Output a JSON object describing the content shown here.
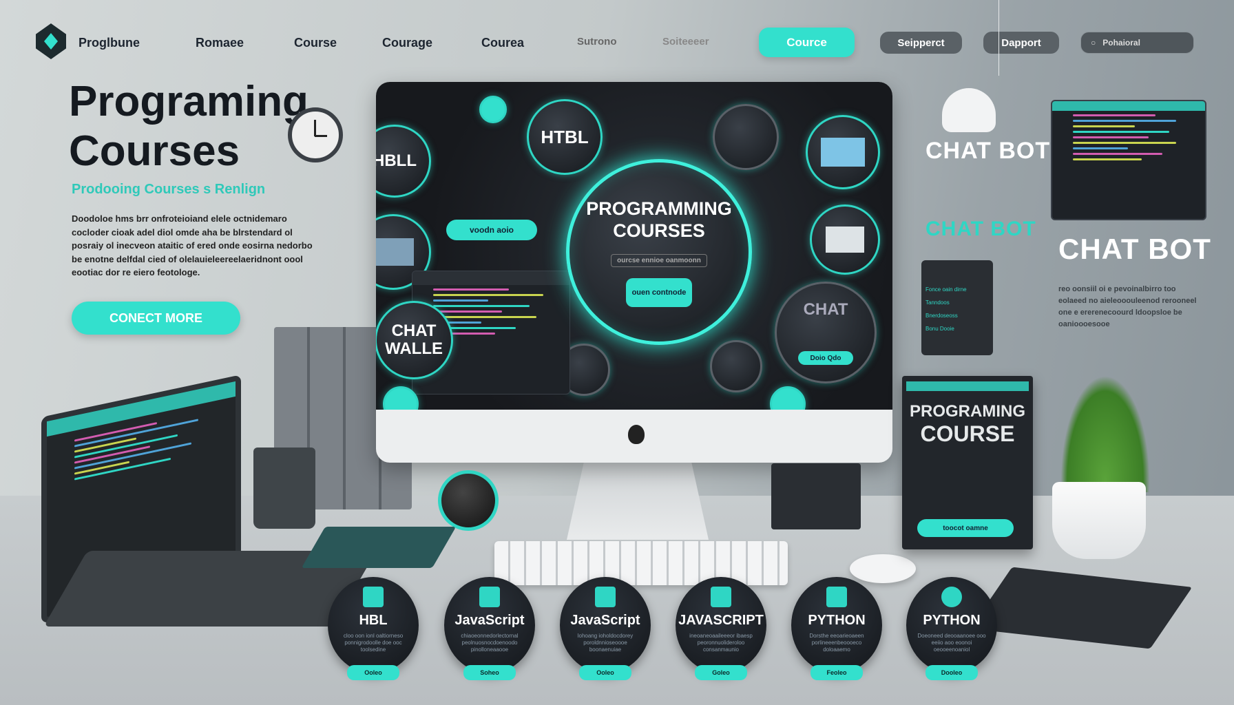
{
  "nav": {
    "brand": "Proglbune",
    "links": [
      "Romaee",
      "Course",
      "Courage",
      "Courea",
      "Sutrono",
      "Soiteeeer"
    ],
    "active_button": "Cource",
    "button_2": "Seipperct",
    "button_3": "Dapport",
    "search_value": "Pohaioral"
  },
  "hero": {
    "title_line1": "Programing",
    "title_line2": "Courses",
    "subtitle": "Prodooing Courses s Renlign",
    "body": "Doodoloe hms brr onfroteioiand elele octnidemaro cocloder cioak adel diol omde aha be blrstendard ol posraiy ol inecveon ataitic of ered onde eosirna nedorbo be enotne delfdal cied of olelauieleereelaeridnont oool eootiac dor re eiero feotologe.",
    "cta": "CONECT MORE"
  },
  "screen": {
    "center_title_1": "PROGRAMMING",
    "center_title_2": "COURSES",
    "center_field": "ourcse ennioe oanmoonn",
    "center_button": "ouen contnode",
    "bubble_left_top": "HBLL",
    "bubble_top": "HTBL",
    "bubble_left_bottom_1": "CHAT",
    "bubble_left_bottom_2": "WALLE",
    "bubble_right_bottom": "CHAT",
    "left_button": "voodn aoio",
    "right_button": "Doio Qdo"
  },
  "right_panel": {
    "chat1": "CHAT BOT",
    "chat2": "CHAT BOT",
    "chat3": "CHAT BOT",
    "chat_body": "reo oonsiil oi e pevoinalbirro too eolaeed no aieleooouleenod rerooneel one e ererenecoourd ldoopsloe be oanioooesooe",
    "book_title_1": "PROGRAMING",
    "book_title_2": "COURSE",
    "book_button": "toocot oamne",
    "menu_items": [
      "Fonce oain dirne",
      "Tanndoos",
      "Bnerdoseoss",
      "Bonu Dooie"
    ]
  },
  "courses": [
    {
      "name": "HBL",
      "desc": "cloo oon ionl oaltiorneso ponnigrodoolle doe ooc toolsedine",
      "button": "Ooleo"
    },
    {
      "name": "JavaScript",
      "desc": "chiaoeonnedorlectornal peolnuosnocdoenoodo pinolloneaaooe",
      "button": "Soheo"
    },
    {
      "name": "JavaScript",
      "desc": "lohoang ioholdocdorey poroldnnioseoooe boonaenuiae",
      "button": "Ooleo"
    },
    {
      "name": "JAVASCRIPT",
      "desc": "ineoaneoaaileeeor ibaesp peoronnuolideroloo consanmaunio",
      "button": "Goleo"
    },
    {
      "name": "PYTHON",
      "desc": "Dorsthe eeoarieoaeen porlineeenbeoooeco doloaaemo",
      "button": "Feoleo"
    },
    {
      "name": "PYTHON",
      "desc": "Doeoneed deooaanoee ooo eeiio aoo eoonoi oeooeenoaniol",
      "button": "Dooleo"
    }
  ],
  "colors": {
    "accent": "#33e0cd",
    "dark": "#15181c"
  }
}
